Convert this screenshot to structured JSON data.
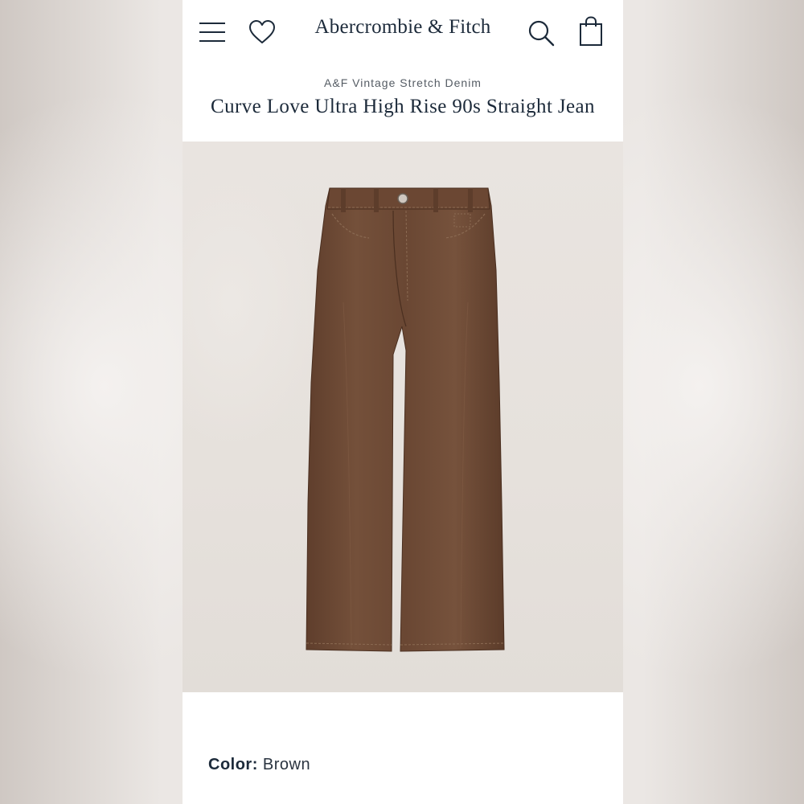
{
  "header": {
    "brand": "Abercrombie & Fitch",
    "icons": [
      "menu-icon",
      "heart-icon",
      "search-icon",
      "bag-icon"
    ]
  },
  "product": {
    "collection": "A&F Vintage Stretch Denim",
    "title": "Curve Love Ultra High Rise 90s Straight Jean",
    "color_label": "Color:",
    "color_value": "Brown"
  },
  "theme": {
    "text": "#1c2a3a",
    "denim": "#6e4a35",
    "background": "#ffffff"
  }
}
